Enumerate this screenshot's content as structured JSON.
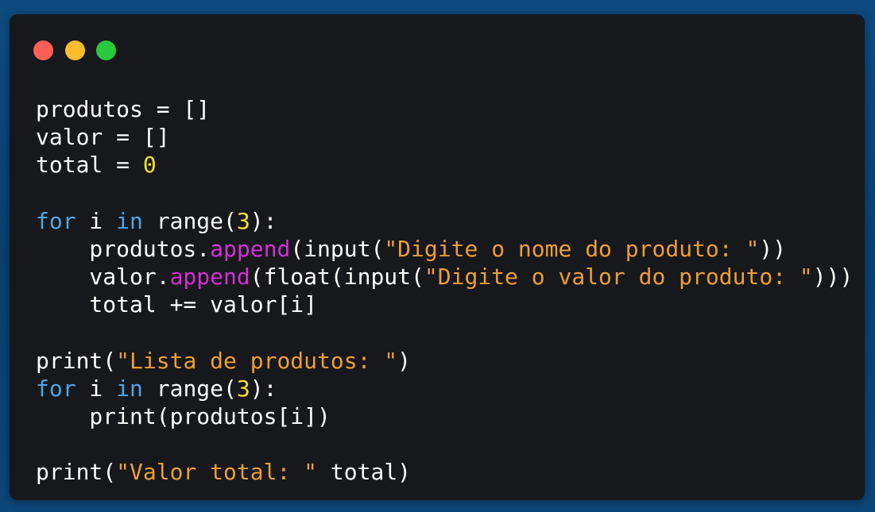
{
  "window": {
    "controls": [
      {
        "name": "close",
        "color": "#ff5f56"
      },
      {
        "name": "minimize",
        "color": "#ffbd2e"
      },
      {
        "name": "maximize",
        "color": "#27c93f"
      }
    ]
  },
  "colors": {
    "background": "#0d4a7f",
    "editor": "#17181b",
    "text": "#ffffff",
    "keyword": "#4ea5e6",
    "number": "#f0e130",
    "string": "#ec9e34",
    "method": "#d22fd6"
  },
  "code": {
    "lines": [
      [
        {
          "t": "produtos = []",
          "c": "plain"
        }
      ],
      [
        {
          "t": "valor = []",
          "c": "plain"
        }
      ],
      [
        {
          "t": "total = ",
          "c": "plain"
        },
        {
          "t": "0",
          "c": "num"
        }
      ],
      [],
      [
        {
          "t": "for",
          "c": "kw"
        },
        {
          "t": " i ",
          "c": "plain"
        },
        {
          "t": "in",
          "c": "kw"
        },
        {
          "t": " range(",
          "c": "plain"
        },
        {
          "t": "3",
          "c": "num"
        },
        {
          "t": "):",
          "c": "plain"
        }
      ],
      [
        {
          "t": "    produtos.",
          "c": "plain"
        },
        {
          "t": "append",
          "c": "meth"
        },
        {
          "t": "(input(",
          "c": "plain"
        },
        {
          "t": "\"Digite o nome do produto: \"",
          "c": "str"
        },
        {
          "t": "))",
          "c": "plain"
        }
      ],
      [
        {
          "t": "    valor.",
          "c": "plain"
        },
        {
          "t": "append",
          "c": "meth"
        },
        {
          "t": "(float(input(",
          "c": "plain"
        },
        {
          "t": "\"Digite o valor do produto: \"",
          "c": "str"
        },
        {
          "t": ")))",
          "c": "plain"
        }
      ],
      [
        {
          "t": "    total += valor[i]",
          "c": "plain"
        }
      ],
      [],
      [
        {
          "t": "print(",
          "c": "plain"
        },
        {
          "t": "\"Lista de produtos: \"",
          "c": "str"
        },
        {
          "t": ")",
          "c": "plain"
        }
      ],
      [
        {
          "t": "for",
          "c": "kw"
        },
        {
          "t": " i ",
          "c": "plain"
        },
        {
          "t": "in",
          "c": "kw"
        },
        {
          "t": " range(",
          "c": "plain"
        },
        {
          "t": "3",
          "c": "num"
        },
        {
          "t": "):",
          "c": "plain"
        }
      ],
      [
        {
          "t": "    print(produtos[i])",
          "c": "plain"
        }
      ],
      [],
      [
        {
          "t": "print(",
          "c": "plain"
        },
        {
          "t": "\"Valor total: \"",
          "c": "str"
        },
        {
          "t": " total)",
          "c": "plain"
        }
      ]
    ]
  }
}
